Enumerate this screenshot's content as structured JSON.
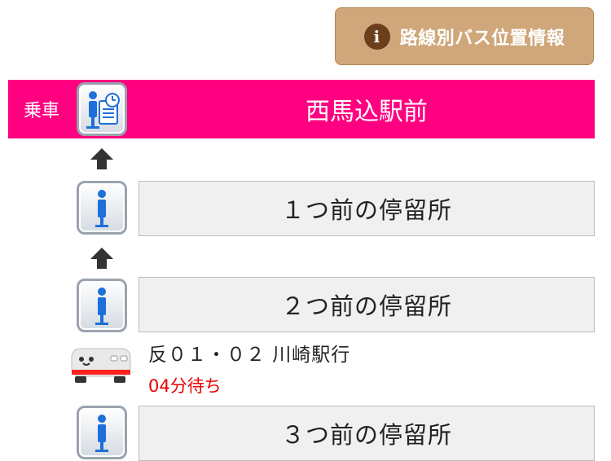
{
  "header": {
    "route_button_label": "路線別バス位置情報",
    "info_icon": "info-icon",
    "info_glyph": "i"
  },
  "boarding": {
    "label": "乗車",
    "stop_name": "西馬込駅前",
    "icon": "bus-stop-timetable-icon"
  },
  "stops": [
    {
      "label": "１つ前の停留所",
      "icon": "bus-stop-icon"
    },
    {
      "label": "２つ前の停留所",
      "icon": "bus-stop-icon"
    },
    {
      "label": "３つ前の停留所",
      "icon": "bus-stop-icon"
    }
  ],
  "bus": {
    "route": "反０１・０２ 川崎駅行",
    "wait": "04分待ち",
    "icon": "bus-icon"
  },
  "colors": {
    "boarding": "#ff0080",
    "route_button": "#cfa77a",
    "wait_text": "#e60000"
  }
}
